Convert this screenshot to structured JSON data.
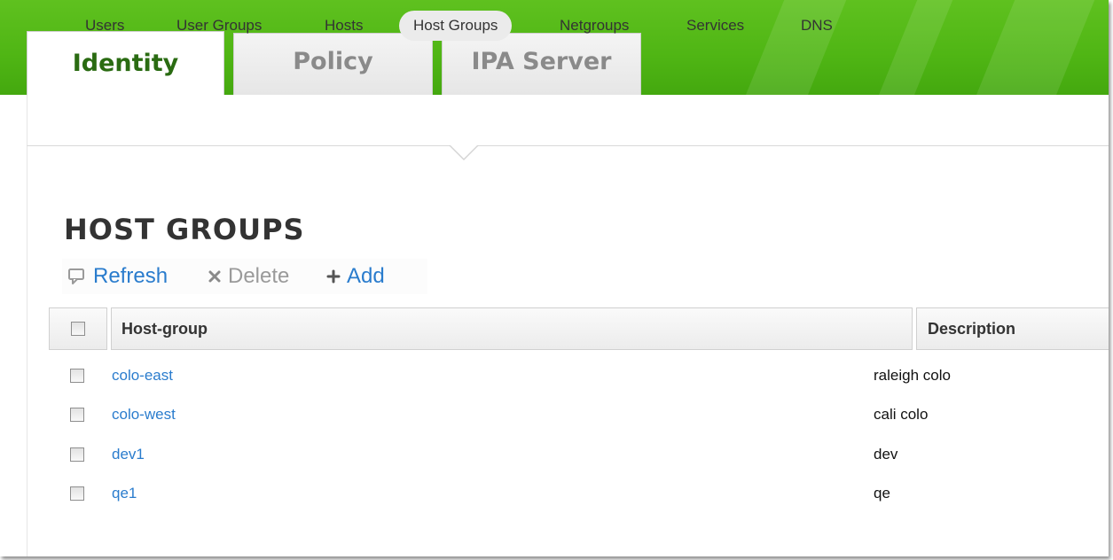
{
  "tabs": [
    {
      "label": "Identity",
      "active": true
    },
    {
      "label": "Policy",
      "active": false
    },
    {
      "label": "IPA Server",
      "active": false
    }
  ],
  "subnav": [
    {
      "label": "Users"
    },
    {
      "label": "User Groups"
    },
    {
      "label": "Hosts"
    },
    {
      "label": "Host Groups",
      "active": true
    },
    {
      "label": "Netgroups"
    },
    {
      "label": "Services"
    },
    {
      "label": "DNS"
    }
  ],
  "page": {
    "title": "HOST GROUPS"
  },
  "actions": {
    "refresh": "Refresh",
    "delete": "Delete",
    "add": "Add"
  },
  "table": {
    "columns": [
      "Host-group",
      "Description"
    ],
    "rows": [
      {
        "name": "colo-east",
        "description": "raleigh colo"
      },
      {
        "name": "colo-west",
        "description": "cali colo"
      },
      {
        "name": "dev1",
        "description": "dev"
      },
      {
        "name": "qe1",
        "description": "qe"
      }
    ]
  },
  "colors": {
    "banner_green": "#4fb514",
    "active_tab_text": "#2a6b12",
    "link_blue": "#2a7ccd"
  },
  "icons": {
    "refresh": "refresh-icon",
    "delete": "close-icon",
    "add": "plus-icon"
  }
}
